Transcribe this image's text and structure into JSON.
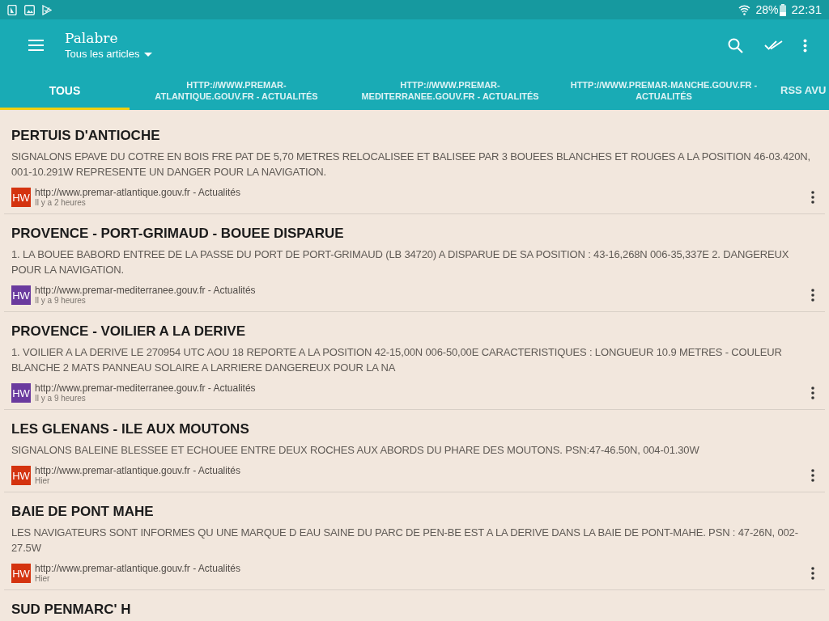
{
  "status_bar": {
    "battery_text": "28%",
    "time": "22:31"
  },
  "app_bar": {
    "title": "Palabre",
    "subtitle": "Tous les articles"
  },
  "tabs": [
    {
      "label": "TOUS",
      "selected": true
    },
    {
      "label": "HTTP://WWW.PREMAR-ATLANTIQUE.GOUV.FR - ACTUALITÉS",
      "selected": false
    },
    {
      "label": "HTTP://WWW.PREMAR-MEDITERRANEE.GOUV.FR - ACTUALITÉS",
      "selected": false
    },
    {
      "label": "HTTP://WWW.PREMAR-MANCHE.GOUV.FR - ACTUALITÉS",
      "selected": false
    },
    {
      "label": "RSS AVU",
      "selected": false
    }
  ],
  "articles": [
    {
      "title": "PERTUIS D'ANTIOCHE",
      "description": "SIGNALONS EPAVE DU COTRE EN BOIS FRE PAT DE 5,70 METRES RELOCALISEE ET BALISEE PAR 3 BOUEES BLANCHES ET ROUGES A LA POSITION 46-03.420N, 001-10.291W REPRESENTE UN DANGER POUR LA NAVIGATION.",
      "badge": "HW",
      "color": "#d4330f",
      "source": "http://www.premar-atlantique.gouv.fr - Actualités",
      "time": "Il y a 2 heures"
    },
    {
      "title": "PROVENCE - PORT-GRIMAUD - BOUEE DISPARUE",
      "description": "1. LA BOUEE BABORD ENTREE DE LA PASSE DU PORT DE PORT-GRIMAUD (LB 34720) A DISPARUE DE SA POSITION : 43-16,268N 006-35,337E 2. DANGEREUX POUR LA NAVIGATION.",
      "badge": "HW",
      "color": "#6a3a9e",
      "source": "http://www.premar-mediterranee.gouv.fr - Actualités",
      "time": "Il y a 9 heures"
    },
    {
      "title": "PROVENCE - VOILIER A LA DERIVE",
      "description": "1. VOILIER A LA DERIVE LE 270954 UTC AOU 18 REPORTE A LA POSITION 42-15,00N 006-50,00E CARACTERISTIQUES : LONGUEUR 10.9 METRES - COULEUR BLANCHE 2 MATS PANNEAU SOLAIRE A LARRIERE DANGEREUX POUR LA NA",
      "badge": "HW",
      "color": "#6a3a9e",
      "source": "http://www.premar-mediterranee.gouv.fr - Actualités",
      "time": "Il y a 9 heures"
    },
    {
      "title": "LES GLENANS - ILE AUX MOUTONS",
      "description": "SIGNALONS BALEINE BLESSEE ET ECHOUEE ENTRE DEUX ROCHES AUX ABORDS DU PHARE DES MOUTONS. PSN:47-46.50N, 004-01.30W",
      "badge": "HW",
      "color": "#d4330f",
      "source": "http://www.premar-atlantique.gouv.fr - Actualités",
      "time": "Hier"
    },
    {
      "title": "BAIE DE PONT MAHE",
      "description": "LES NAVIGATEURS SONT INFORMES QU UNE MARQUE D EAU SAINE DU PARC DE PEN-BE EST A LA DERIVE DANS LA BAIE DE PONT-MAHE. PSN : 47-26N, 002-27.5W",
      "badge": "HW",
      "color": "#d4330f",
      "source": "http://www.premar-atlantique.gouv.fr - Actualités",
      "time": "Hier"
    },
    {
      "title": "SUD PENMARC' H"
    }
  ]
}
